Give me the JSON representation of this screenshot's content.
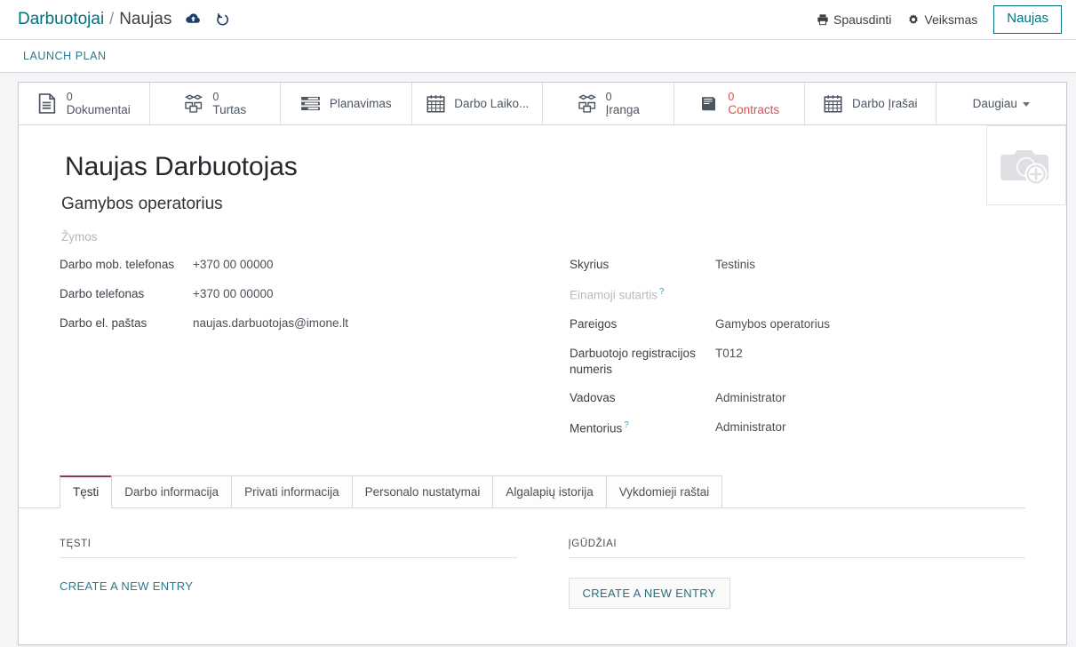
{
  "header": {
    "breadcrumb_root": "Darbuotojai",
    "breadcrumb_sep": "/",
    "breadcrumb_current": "Naujas",
    "save_icon": "cloud-upload-icon",
    "discard_icon": "undo-icon",
    "print_label": "Spausdinti",
    "action_label": "Veiksmas",
    "new_label": "Naujas"
  },
  "subnav": {
    "item_label": "LAUNCH PLAN"
  },
  "statbuttons": [
    {
      "count": "0",
      "label": "Dokumentai",
      "icon": "document-icon",
      "danger": false
    },
    {
      "count": "0",
      "label": "Turtas",
      "icon": "boxes-icon",
      "danger": false
    },
    {
      "count": "",
      "label": "Planavimas",
      "icon": "planning-icon",
      "danger": false
    },
    {
      "count": "",
      "label": "Darbo Laiko...",
      "icon": "calendar-icon",
      "danger": false
    },
    {
      "count": "0",
      "label": "Įranga",
      "icon": "boxes-icon",
      "danger": false
    },
    {
      "count": "0",
      "label": "Contracts",
      "icon": "book-icon",
      "danger": true
    },
    {
      "count": "",
      "label": "Darbo Įrašai",
      "icon": "calendar-icon",
      "danger": false
    }
  ],
  "more_button": {
    "label": "Daugiau",
    "icon": "chevron-down-icon"
  },
  "record": {
    "title": "Naujas Darbuotojas",
    "subtitle": "Gamybos operatorius",
    "tags_placeholder": "Žymos",
    "avatar_icon": "camera-add-icon"
  },
  "fields_left": [
    {
      "label": "Darbo mob. telefonas",
      "value": "+370 00 00000",
      "muted": false,
      "help": false
    },
    {
      "label": "Darbo telefonas",
      "value": "+370 00 00000",
      "muted": false,
      "help": false
    },
    {
      "label": "Darbo el. paštas",
      "value": "naujas.darbuotojas@imone.lt",
      "muted": false,
      "help": false
    }
  ],
  "fields_right": [
    {
      "label": "Skyrius",
      "value": "Testinis",
      "muted": false,
      "help": false
    },
    {
      "label": "Einamoji sutartis",
      "value": "",
      "muted": true,
      "help": true
    },
    {
      "label": "Pareigos",
      "value": "Gamybos operatorius",
      "muted": false,
      "help": false
    },
    {
      "label": "Darbuotojo registracijos numeris",
      "value": "T012",
      "muted": false,
      "help": false
    },
    {
      "label": "Vadovas",
      "value": "Administrator",
      "muted": false,
      "help": false
    },
    {
      "label": "Mentorius",
      "value": "Administrator",
      "muted": false,
      "help": true
    }
  ],
  "notebook": {
    "tabs": [
      {
        "label": "Tęsti",
        "active": true
      },
      {
        "label": "Darbo informacija",
        "active": false
      },
      {
        "label": "Privati informacija",
        "active": false
      },
      {
        "label": "Personalo nustatymai",
        "active": false
      },
      {
        "label": "Algalapių istorija",
        "active": false
      },
      {
        "label": "Vykdomieji raštai",
        "active": false
      }
    ],
    "left_section_title": "TĘSTI",
    "left_action_label": "CREATE A NEW ENTRY",
    "right_section_title": "ĮGŪDŽIAI",
    "right_action_label": "CREATE A NEW ENTRY"
  },
  "colors": {
    "accent": "#00707f",
    "link": "#2a7a8c",
    "danger": "#d9534f",
    "tab_active_border": "#8a3d4a",
    "page_bg": "#f4f5f7"
  }
}
